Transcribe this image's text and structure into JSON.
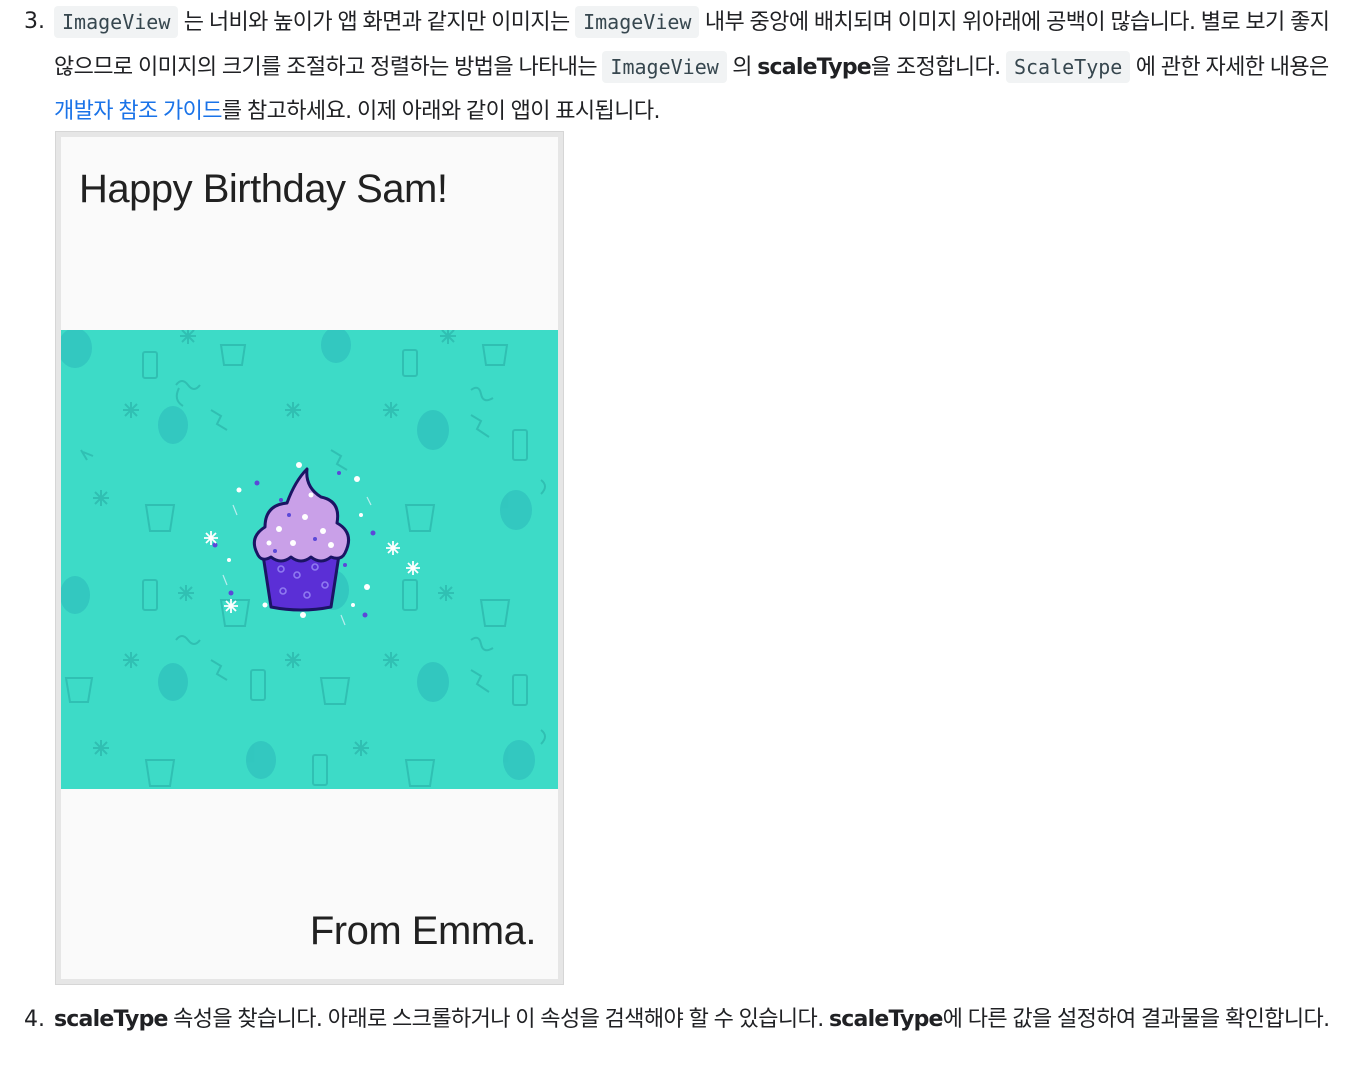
{
  "step3": {
    "number": "3.",
    "code_imageview_1": "ImageView",
    "text_1": "는 너비와 높이가 앱 화면과 같지만 이미지는",
    "code_imageview_2": "ImageView",
    "text_2": "내부 중앙에 배치되며 이미지 위아래에 공백이 많습니다. 별로 보기 좋지 않으므로 이미지의 크기를 조절하고 정렬하는 방법을 나타내는",
    "code_imageview_3": "ImageView",
    "text_3": "의",
    "bold_scaletype": "scaleType",
    "text_4": "을 조정합니다.",
    "code_scaletype": "ScaleType",
    "text_5": "에 관한 자세한 내용은",
    "link_label": "개발자 참조 가이드",
    "text_6": "를 참고하세요. 이제 아래와 같이 앱이 표시됩니다."
  },
  "phone": {
    "greeting": "Happy Birthday Sam!",
    "signoff": "From Emma.",
    "image_bg": "#3ddbc7",
    "screen_bg": "#fafafa"
  },
  "step4": {
    "number": "4.",
    "bold_1": "scaleType",
    "text_1": "속성을 찾습니다. 아래로 스크롤하거나 이 속성을 검색해야 할 수 있습니다.",
    "bold_2": "scaleType",
    "text_2": "에 다른 값을 설정하여 결과물을 확인합니다."
  },
  "icons": {
    "cupcake": "cupcake-icon"
  }
}
